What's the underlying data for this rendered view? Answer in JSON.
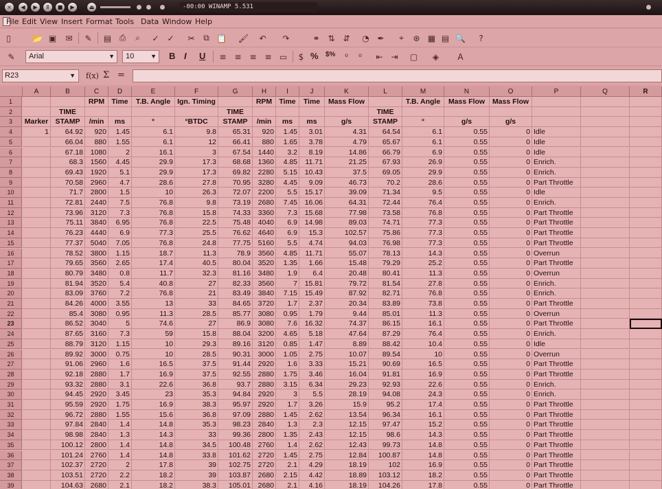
{
  "winamp": {
    "title": "-00:00 WINAMP 5.531"
  },
  "menu": [
    "File",
    "Edit",
    "View",
    "Insert",
    "Format",
    "Tools",
    "Data",
    "Window",
    "Help"
  ],
  "formatting": {
    "font": "Arial",
    "size": "10",
    "bold": "B",
    "italic": "I",
    "underline": "U",
    "percent": "%",
    "currency": "$%"
  },
  "formula_bar": {
    "cell_ref": "R23",
    "func_wizard": "f(x)",
    "sum": "Σ",
    "equals": "=",
    "value": ""
  },
  "columns": [
    "A",
    "B",
    "C",
    "D",
    "E",
    "F",
    "G",
    "H",
    "I",
    "J",
    "K",
    "L",
    "M",
    "N",
    "O",
    "P",
    "Q",
    "R"
  ],
  "header_rows": [
    [
      "",
      "",
      "RPM",
      "Time",
      "T.B. Angle",
      "Ign. Timing",
      "",
      "RPM",
      "Time",
      "Time",
      "Mass Flow",
      "",
      "T.B. Angle",
      "Mass Flow",
      "Mass Flow",
      "",
      "",
      ""
    ],
    [
      "",
      "TIME",
      "",
      "",
      "",
      "",
      "TIME",
      "",
      "",
      "",
      "",
      "TIME",
      "",
      "",
      "",
      "",
      "",
      ""
    ],
    [
      "Marker",
      "STAMP",
      "/min",
      "ms",
      "°",
      "°BTDC",
      "STAMP",
      "/min",
      "ms",
      "ms",
      "g/s",
      "STAMP",
      "°",
      "g/s",
      "g/s",
      "",
      "",
      ""
    ]
  ],
  "data_rows": [
    [
      "1",
      "64.92",
      "920",
      "1.45",
      "6.1",
      "9.8",
      "65.31",
      "920",
      "1.45",
      "3.01",
      "4.31",
      "64.54",
      "6.1",
      "0.55",
      "0",
      "Idle"
    ],
    [
      "",
      "66.04",
      "880",
      "1.55",
      "6.1",
      "12",
      "66.41",
      "880",
      "1.65",
      "3.78",
      "4.79",
      "65.67",
      "6.1",
      "0.55",
      "0",
      "Idle"
    ],
    [
      "",
      "67.18",
      "1080",
      "2",
      "16.1",
      "3",
      "67.54",
      "1440",
      "3.2",
      "8.19",
      "14.86",
      "66.79",
      "6.9",
      "0.55",
      "0",
      "Idle"
    ],
    [
      "",
      "68.3",
      "1560",
      "4.45",
      "29.9",
      "17.3",
      "68.68",
      "1360",
      "4.85",
      "11.71",
      "21.25",
      "67.93",
      "26.9",
      "0.55",
      "0",
      "Enrich."
    ],
    [
      "",
      "69.43",
      "1920",
      "5.1",
      "29.9",
      "17.3",
      "69.82",
      "2280",
      "5.15",
      "10.43",
      "37.5",
      "69.05",
      "29.9",
      "0.55",
      "0",
      "Enrich."
    ],
    [
      "",
      "70.58",
      "2960",
      "4.7",
      "28.6",
      "27.8",
      "70.95",
      "3280",
      "4.45",
      "9.09",
      "46.73",
      "70.2",
      "28.6",
      "0.55",
      "0",
      "Part Throttle"
    ],
    [
      "",
      "71.7",
      "2800",
      "1.5",
      "10",
      "26.3",
      "72.07",
      "2200",
      "5.5",
      "15.17",
      "39.09",
      "71.34",
      "9.5",
      "0.55",
      "0",
      "Idle"
    ],
    [
      "",
      "72.81",
      "2440",
      "7.5",
      "76.8",
      "9.8",
      "73.19",
      "2680",
      "7.45",
      "16.06",
      "64.31",
      "72.44",
      "76.4",
      "0.55",
      "0",
      "Enrich."
    ],
    [
      "",
      "73.96",
      "3120",
      "7.3",
      "76.8",
      "15.8",
      "74.33",
      "3360",
      "7.3",
      "15.68",
      "77.98",
      "73.58",
      "76.8",
      "0.55",
      "0",
      "Part Throttle"
    ],
    [
      "",
      "75.11",
      "3840",
      "6.95",
      "76.8",
      "22.5",
      "75.48",
      "4040",
      "6.9",
      "14.98",
      "89.03",
      "74.71",
      "77.3",
      "0.55",
      "0",
      "Part Throttle"
    ],
    [
      "",
      "76.23",
      "4440",
      "6.9",
      "77.3",
      "25.5",
      "76.62",
      "4640",
      "6.9",
      "15.3",
      "102.57",
      "75.86",
      "77.3",
      "0.55",
      "0",
      "Part Throttle"
    ],
    [
      "",
      "77.37",
      "5040",
      "7.05",
      "76.8",
      "24.8",
      "77.75",
      "5160",
      "5.5",
      "4.74",
      "94.03",
      "76.98",
      "77.3",
      "0.55",
      "0",
      "Part Throttle"
    ],
    [
      "",
      "78.52",
      "3800",
      "1.15",
      "18.7",
      "11.3",
      "78.9",
      "3560",
      "4.85",
      "11.71",
      "55.07",
      "78.13",
      "14.3",
      "0.55",
      "0",
      "Overrun"
    ],
    [
      "",
      "79.65",
      "3560",
      "2.65",
      "17.4",
      "40.5",
      "80.04",
      "3520",
      "1.35",
      "1.66",
      "15.48",
      "79.29",
      "25.2",
      "0.55",
      "0",
      "Part Throttle"
    ],
    [
      "",
      "80.79",
      "3480",
      "0.8",
      "11.7",
      "32.3",
      "81.16",
      "3480",
      "1.9",
      "6.4",
      "20.48",
      "80.41",
      "11.3",
      "0.55",
      "0",
      "Overrun"
    ],
    [
      "",
      "81.94",
      "3520",
      "5.4",
      "40.8",
      "27",
      "82.33",
      "3560",
      "7",
      "15.81",
      "79.72",
      "81.54",
      "27.8",
      "0.55",
      "0",
      "Enrich."
    ],
    [
      "",
      "83.09",
      "3760",
      "7.2",
      "76.8",
      "21",
      "83.49",
      "3840",
      "7.15",
      "15.49",
      "87.92",
      "82.71",
      "76.8",
      "0.55",
      "0",
      "Enrich."
    ],
    [
      "",
      "84.26",
      "4000",
      "3.55",
      "13",
      "33",
      "84.65",
      "3720",
      "1.7",
      "2.37",
      "20.34",
      "83.89",
      "73.8",
      "0.55",
      "0",
      "Part Throttle"
    ],
    [
      "",
      "85.4",
      "3080",
      "0.95",
      "11.3",
      "28.5",
      "85.77",
      "3080",
      "0.95",
      "1.79",
      "9.44",
      "85.01",
      "11.3",
      "0.55",
      "0",
      "Overrun"
    ],
    [
      "",
      "86.52",
      "3040",
      "5",
      "74.6",
      "27",
      "86.9",
      "3080",
      "7.6",
      "16.32",
      "74.37",
      "86.15",
      "16.1",
      "0.55",
      "0",
      "Part Throttle"
    ],
    [
      "",
      "87.65",
      "3160",
      "7.3",
      "59",
      "15.8",
      "88.04",
      "3200",
      "4.65",
      "5.18",
      "47.64",
      "87.29",
      "76.4",
      "0.55",
      "0",
      "Enrich."
    ],
    [
      "",
      "88.79",
      "3120",
      "1.15",
      "10",
      "29.3",
      "89.16",
      "3120",
      "0.85",
      "1.47",
      "8.89",
      "88.42",
      "10.4",
      "0.55",
      "0",
      "Idle"
    ],
    [
      "",
      "89.92",
      "3000",
      "0.75",
      "10",
      "28.5",
      "90.31",
      "3000",
      "1.05",
      "2.75",
      "10.07",
      "89.54",
      "10",
      "0.55",
      "0",
      "Overrun"
    ],
    [
      "",
      "91.06",
      "2960",
      "1.6",
      "16.5",
      "37.5",
      "91.44",
      "2920",
      "1.6",
      "3.33",
      "15.21",
      "90.69",
      "16.5",
      "0.55",
      "0",
      "Part Throttle"
    ],
    [
      "",
      "92.18",
      "2880",
      "1.7",
      "16.9",
      "37.5",
      "92.55",
      "2880",
      "1.75",
      "3.46",
      "16.04",
      "91.81",
      "16.9",
      "0.55",
      "0",
      "Part Throttle"
    ],
    [
      "",
      "93.32",
      "2880",
      "3.1",
      "22.6",
      "36.8",
      "93.7",
      "2880",
      "3.15",
      "6.34",
      "29.23",
      "92.93",
      "22.6",
      "0.55",
      "0",
      "Enrich."
    ],
    [
      "",
      "94.45",
      "2920",
      "3.45",
      "23",
      "35.3",
      "94.84",
      "2920",
      "3",
      "5.5",
      "28.19",
      "94.08",
      "24.3",
      "0.55",
      "0",
      "Enrich."
    ],
    [
      "",
      "95.59",
      "2920",
      "1.75",
      "16.9",
      "38.3",
      "95.97",
      "2920",
      "1.7",
      "3.26",
      "15.9",
      "95.2",
      "17.4",
      "0.55",
      "0",
      "Part Throttle"
    ],
    [
      "",
      "96.72",
      "2880",
      "1.55",
      "15.6",
      "36.8",
      "97.09",
      "2880",
      "1.45",
      "2.62",
      "13.54",
      "96.34",
      "16.1",
      "0.55",
      "0",
      "Part Throttle"
    ],
    [
      "",
      "97.84",
      "2840",
      "1.4",
      "14.8",
      "35.3",
      "98.23",
      "2840",
      "1.3",
      "2.3",
      "12.15",
      "97.47",
      "15.2",
      "0.55",
      "0",
      "Part Throttle"
    ],
    [
      "",
      "98.98",
      "2840",
      "1.3",
      "14.3",
      "33",
      "99.36",
      "2800",
      "1.35",
      "2.43",
      "12.15",
      "98.6",
      "14.3",
      "0.55",
      "0",
      "Part Throttle"
    ],
    [
      "",
      "100.12",
      "2800",
      "1.4",
      "14.8",
      "34.5",
      "100.48",
      "2760",
      "1.4",
      "2.62",
      "12.43",
      "99.73",
      "14.8",
      "0.55",
      "0",
      "Part Throttle"
    ],
    [
      "",
      "101.24",
      "2760",
      "1.4",
      "14.8",
      "33.8",
      "101.62",
      "2720",
      "1.45",
      "2.75",
      "12.84",
      "100.87",
      "14.8",
      "0.55",
      "0",
      "Part Throttle"
    ],
    [
      "",
      "102.37",
      "2720",
      "2",
      "17.8",
      "39",
      "102.75",
      "2720",
      "2.1",
      "4.29",
      "18.19",
      "102",
      "16.9",
      "0.55",
      "0",
      "Part Throttle"
    ],
    [
      "",
      "103.51",
      "2720",
      "2.2",
      "18.2",
      "39",
      "103.87",
      "2680",
      "2.15",
      "4.42",
      "18.89",
      "103.12",
      "18.2",
      "0.55",
      "0",
      "Part Throttle"
    ],
    [
      "",
      "104.63",
      "2680",
      "2.1",
      "18.2",
      "38.3",
      "105.01",
      "2680",
      "2.1",
      "4.16",
      "18.19",
      "104.26",
      "17.8",
      "0.55",
      "0",
      "Part Throttle"
    ]
  ]
}
